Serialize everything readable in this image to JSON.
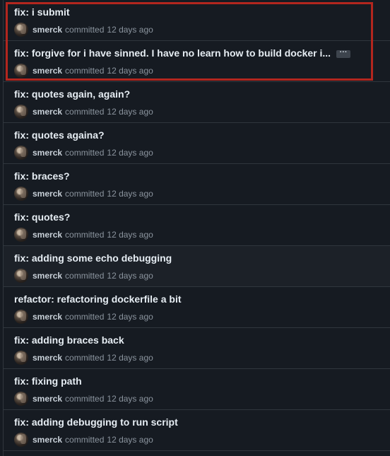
{
  "commits": [
    {
      "title": "fix: i submit",
      "author": "smerck",
      "committed": "committed",
      "time": "12 days ago",
      "truncated": false
    },
    {
      "title": "fix: forgive for i have sinned. I have no learn how to build docker i...",
      "author": "smerck",
      "committed": "committed",
      "time": "12 days ago",
      "truncated": true,
      "ellipsis_label": "···"
    },
    {
      "title": "fix: quotes again, again?",
      "author": "smerck",
      "committed": "committed",
      "time": "12 days ago",
      "truncated": false
    },
    {
      "title": "fix: quotes againa?",
      "author": "smerck",
      "committed": "committed",
      "time": "12 days ago",
      "truncated": false
    },
    {
      "title": "fix: braces?",
      "author": "smerck",
      "committed": "committed",
      "time": "12 days ago",
      "truncated": false
    },
    {
      "title": "fix: quotes?",
      "author": "smerck",
      "committed": "committed",
      "time": "12 days ago",
      "truncated": false
    },
    {
      "title": "fix: adding some echo debugging",
      "author": "smerck",
      "committed": "committed",
      "time": "12 days ago",
      "truncated": false,
      "hovered": true
    },
    {
      "title": "refactor: refactoring dockerfile a bit",
      "author": "smerck",
      "committed": "committed",
      "time": "12 days ago",
      "truncated": false
    },
    {
      "title": "fix: adding braces back",
      "author": "smerck",
      "committed": "committed",
      "time": "12 days ago",
      "truncated": false
    },
    {
      "title": "fix: fixing path",
      "author": "smerck",
      "committed": "committed",
      "time": "12 days ago",
      "truncated": false
    },
    {
      "title": "fix: adding debugging to run script",
      "author": "smerck",
      "committed": "committed",
      "time": "12 days ago",
      "truncated": false
    }
  ],
  "highlight_color": "#b3261e"
}
